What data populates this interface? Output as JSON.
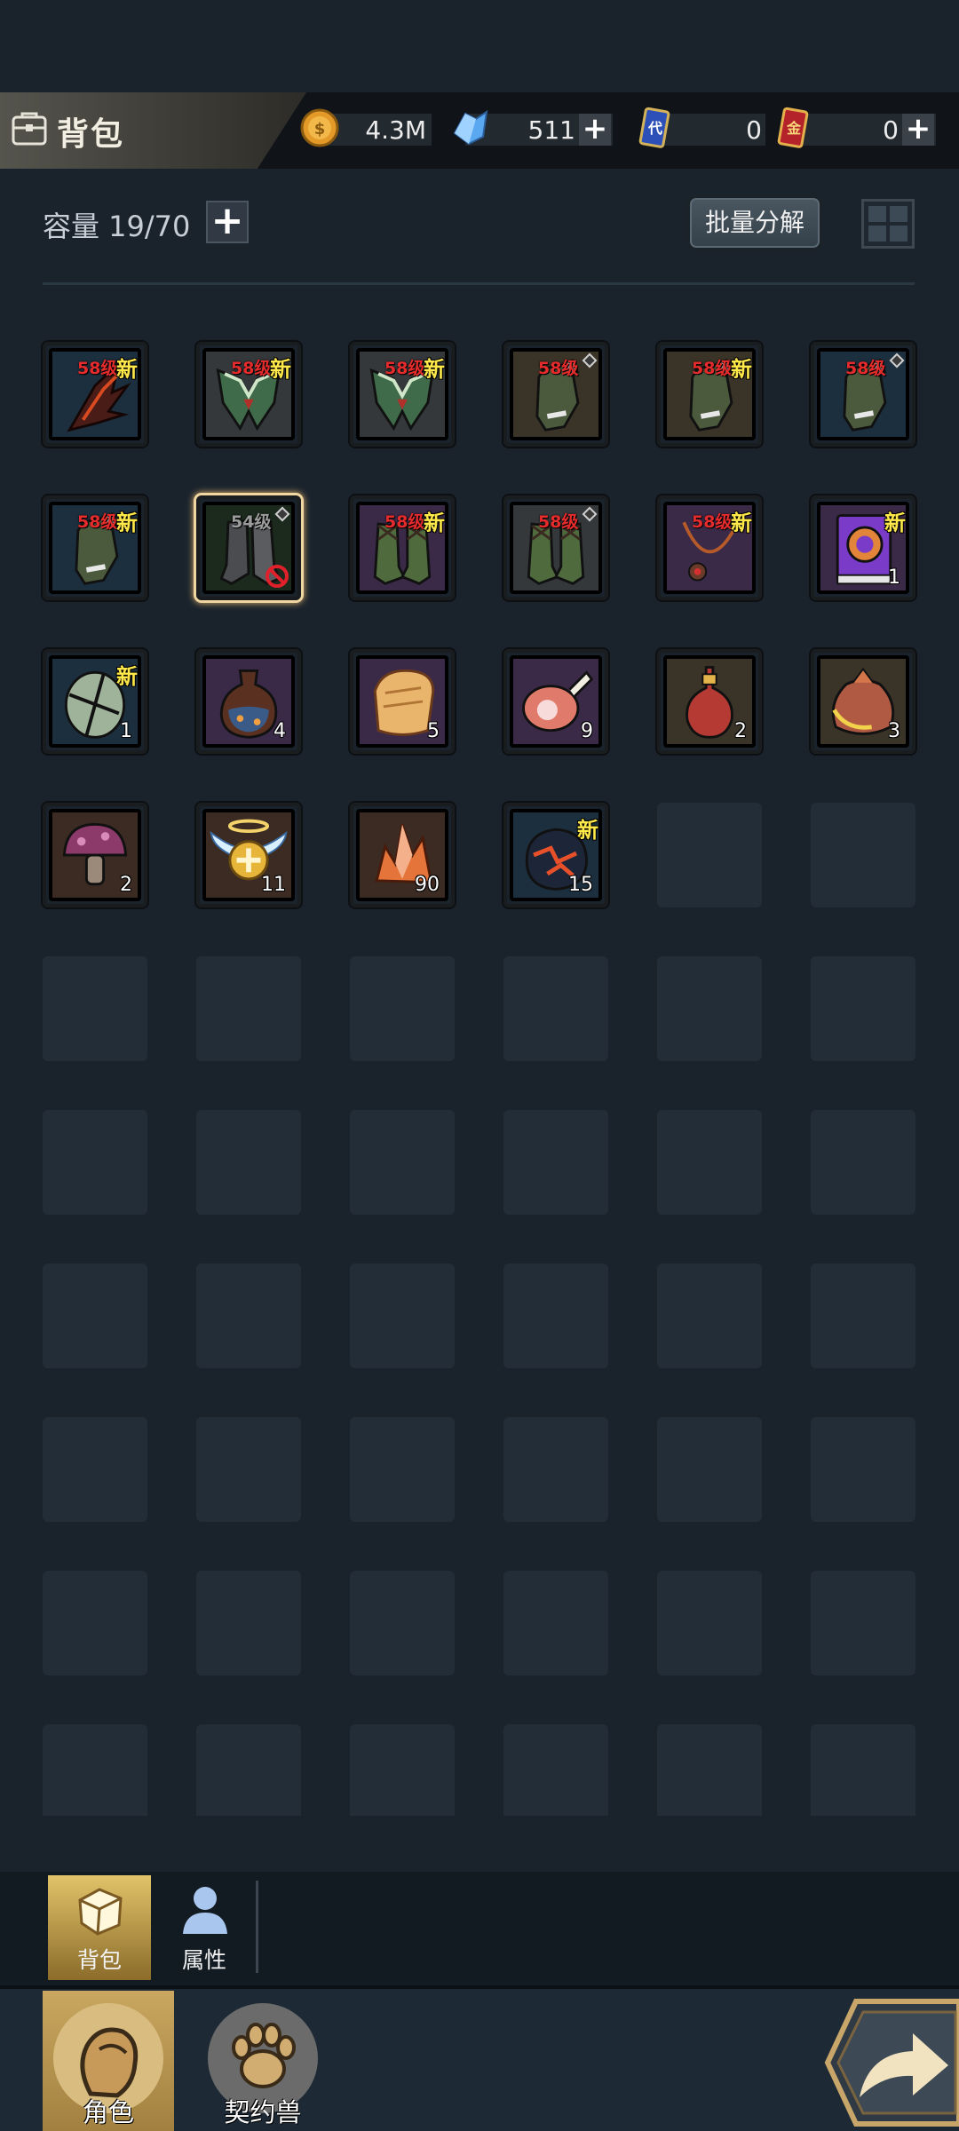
{
  "header": {
    "title": "背包",
    "currencies": [
      {
        "name": "gold",
        "icon": "gold-coin-icon",
        "value": "4.3M",
        "has_plus": false
      },
      {
        "name": "crystal",
        "icon": "blue-crystal-icon",
        "value": "511",
        "has_plus": true
      },
      {
        "name": "blue-card",
        "icon": "blue-card-icon",
        "value": "0",
        "has_plus": false
      },
      {
        "name": "gold-card",
        "icon": "red-gold-card-icon",
        "value": "0",
        "has_plus": true
      }
    ]
  },
  "capacity": {
    "label": "容量 19/70",
    "used": 19,
    "total": 70
  },
  "batch_button": "批量分解",
  "bag": {
    "items": [
      {
        "type": "claw",
        "rarity": "blue",
        "level": "58级",
        "new": "新"
      },
      {
        "type": "green-armor",
        "rarity": "white",
        "level": "58级",
        "new": "新"
      },
      {
        "type": "green-armor",
        "rarity": "white",
        "level": "58级",
        "new": "新"
      },
      {
        "type": "bracer",
        "rarity": "gold",
        "level": "58级",
        "diamond": true
      },
      {
        "type": "bracer",
        "rarity": "gold",
        "level": "58级",
        "new": "新"
      },
      {
        "type": "bracer",
        "rarity": "blue",
        "level": "58级",
        "diamond": true
      },
      {
        "type": "bracer",
        "rarity": "blue",
        "level": "58级",
        "new": "新"
      },
      {
        "type": "dark-boots",
        "rarity": "green",
        "level": "54级",
        "diamond": true,
        "selected": true,
        "banned": true
      },
      {
        "type": "boots",
        "rarity": "purple",
        "level": "58级",
        "new": "新"
      },
      {
        "type": "boots",
        "rarity": "white",
        "level": "58级",
        "diamond": true
      },
      {
        "type": "necklace",
        "rarity": "purple",
        "level": "58级",
        "new": "新"
      },
      {
        "type": "book",
        "rarity": "purple",
        "new": "新",
        "count": "1"
      },
      {
        "type": "cracked-egg",
        "rarity": "blue",
        "new": "新",
        "count": "1"
      },
      {
        "type": "potion-dark",
        "rarity": "purple",
        "count": "4"
      },
      {
        "type": "bread",
        "rarity": "purple",
        "count": "5"
      },
      {
        "type": "meat",
        "rarity": "purple",
        "count": "9"
      },
      {
        "type": "potion-red",
        "rarity": "gold",
        "count": "2"
      },
      {
        "type": "pouch",
        "rarity": "gold",
        "count": "3"
      },
      {
        "type": "mushroom",
        "rarity": "orange",
        "count": "2"
      },
      {
        "type": "angel-badge",
        "rarity": "orange",
        "count": "11"
      },
      {
        "type": "crystal-ore",
        "rarity": "orange",
        "count": "90"
      },
      {
        "type": "lava-ore",
        "rarity": "blue",
        "new": "新",
        "count": "15"
      }
    ]
  },
  "sub_tabs": [
    {
      "label": "背包",
      "icon": "bag-icon",
      "active": true
    },
    {
      "label": "属性",
      "icon": "person-icon",
      "active": false
    }
  ],
  "main_nav": [
    {
      "label": "角色",
      "icon": "character-head-icon",
      "active": true
    },
    {
      "label": "契约兽",
      "icon": "paw-icon",
      "active": false
    }
  ],
  "colors": {
    "background": "#1a232c",
    "rarity_blue": "#26aee0",
    "rarity_white": "#e6e6e6",
    "rarity_gold": "#e0b54a",
    "rarity_purple": "#b146d8",
    "rarity_orange": "#ec7a32",
    "level_text": "#e52b2b",
    "new_text": "#ffe84a"
  }
}
